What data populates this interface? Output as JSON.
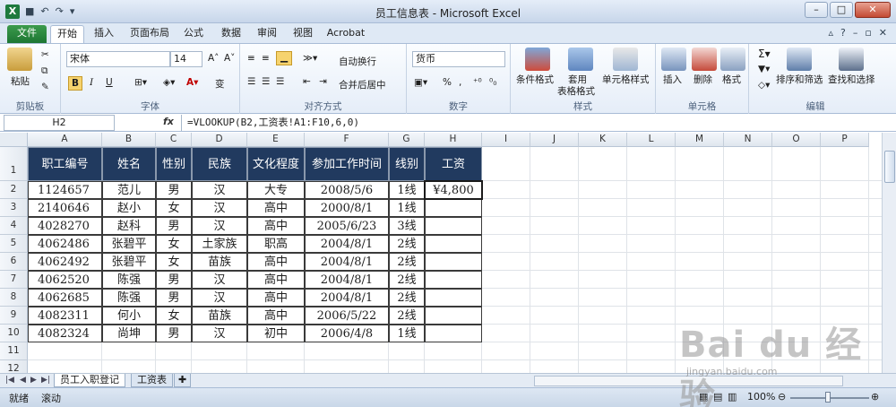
{
  "window": {
    "title": "员工信息表 - Microsoft Excel"
  },
  "tabs": [
    {
      "label": "文件"
    },
    {
      "label": "开始"
    },
    {
      "label": "插入"
    },
    {
      "label": "页面布局"
    },
    {
      "label": "公式"
    },
    {
      "label": "数据"
    },
    {
      "label": "审阅"
    },
    {
      "label": "视图"
    },
    {
      "label": "Acrobat"
    }
  ],
  "ribbon": {
    "clipboard": {
      "paste": "粘贴",
      "group": "剪贴板"
    },
    "font": {
      "name": "宋体",
      "size": "14",
      "bold": "B",
      "italic": "I",
      "underline": "U",
      "group": "字体",
      "phonetic": "变"
    },
    "alignment": {
      "wrap": "自动换行",
      "merge": "合并后居中",
      "group": "对齐方式"
    },
    "number": {
      "format": "货币",
      "percent": "%",
      "comma": ",",
      "group": "数字"
    },
    "styles": {
      "conditional": "条件格式",
      "table_line1": "套用",
      "table_line2": "表格格式",
      "cell_styles": "单元格样式",
      "group": "样式"
    },
    "cells": {
      "insert": "插入",
      "delete": "删除",
      "format": "格式",
      "group": "单元格"
    },
    "editing": {
      "sort": "排序和筛选",
      "find": "查找和选择",
      "group": "编辑"
    }
  },
  "formula_bar": {
    "name_box": "H2",
    "fx": "fx",
    "formula": "=VLOOKUP(B2,工资表!A1:F10,6,0)"
  },
  "columns": [
    "A",
    "B",
    "C",
    "D",
    "E",
    "F",
    "G",
    "H",
    "I",
    "J",
    "K",
    "L",
    "M",
    "N",
    "O",
    "P"
  ],
  "rows": [
    "1",
    "2",
    "3",
    "4",
    "5",
    "6",
    "7",
    "8",
    "9",
    "10",
    "11",
    "12",
    "13"
  ],
  "table": {
    "headers": [
      "职工编号",
      "姓名",
      "性别",
      "民族",
      "文化程度",
      "参加工作时间",
      "线别",
      "工资"
    ],
    "rows": [
      [
        "1124657",
        "范儿",
        "男",
        "汉",
        "大专",
        "2008/5/6",
        "1线",
        "¥4,800"
      ],
      [
        "2140646",
        "赵小",
        "女",
        "汉",
        "高中",
        "2000/8/1",
        "1线",
        ""
      ],
      [
        "4028270",
        "赵科",
        "男",
        "汉",
        "高中",
        "2005/6/23",
        "3线",
        ""
      ],
      [
        "4062486",
        "张碧平",
        "女",
        "土家族",
        "职高",
        "2004/8/1",
        "2线",
        ""
      ],
      [
        "4062492",
        "张碧平",
        "女",
        "苗族",
        "高中",
        "2004/8/1",
        "2线",
        ""
      ],
      [
        "4062520",
        "陈强",
        "男",
        "汉",
        "高中",
        "2004/8/1",
        "2线",
        ""
      ],
      [
        "4062685",
        "陈强",
        "男",
        "汉",
        "高中",
        "2004/8/1",
        "2线",
        ""
      ],
      [
        "4082311",
        "何小",
        "女",
        "苗族",
        "高中",
        "2006/5/22",
        "2线",
        ""
      ],
      [
        "4082324",
        "尚坤",
        "男",
        "汉",
        "初中",
        "2006/4/8",
        "1线",
        ""
      ]
    ]
  },
  "sheets": [
    {
      "label": "员工入职登记"
    },
    {
      "label": "工资表"
    }
  ],
  "status": {
    "ready": "就绪",
    "scroll": "滚动",
    "zoom": "100%"
  },
  "watermark": {
    "brand": "Bai du 经验",
    "url": "jingyan.baidu.com"
  }
}
